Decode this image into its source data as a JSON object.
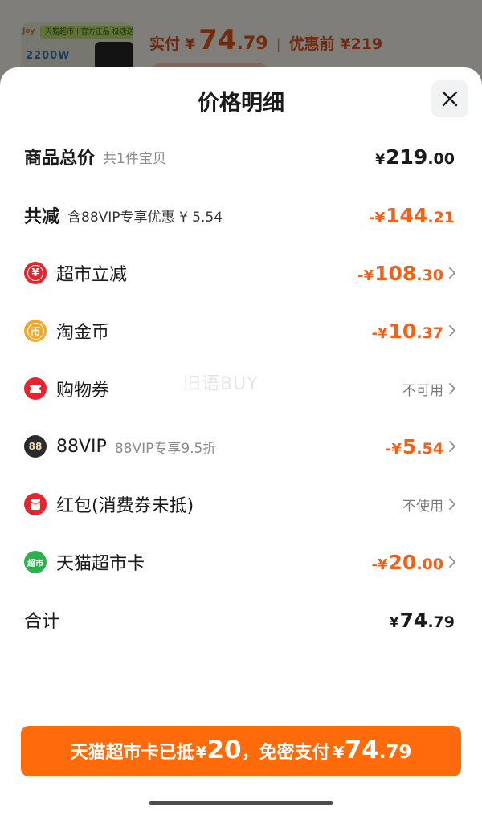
{
  "background": {
    "thumb_tag": "天猫超市 | 官方正品 极速送达",
    "thumb_brand": "Joy",
    "thumb_watt": "2200W",
    "price_label": "实付",
    "price_yen": "¥",
    "price_int": "74",
    "price_dec": ".79",
    "separator": "|",
    "prediscount": "优惠前 ¥219"
  },
  "title": "价格明细",
  "rows": {
    "total": {
      "label": "商品总价",
      "sub": "共1件宝贝",
      "yen": "¥",
      "int": "219",
      "dec": ".00"
    },
    "reduction": {
      "label": "共减",
      "sub": "含88VIP专享优惠 ¥ 5.54",
      "sign": "-¥",
      "int": "144",
      "dec": ".21"
    },
    "supermarket": {
      "label": "超市立减",
      "sign": "-¥",
      "int": "108",
      "dec": ".30"
    },
    "coins": {
      "label": "淘金币",
      "sign": "-¥",
      "int": "10",
      "dec": ".37"
    },
    "voucher": {
      "label": "购物券",
      "status": "不可用"
    },
    "vip": {
      "label": "88VIP",
      "sub": "88VIP专享9.5折",
      "sign": "-¥",
      "int": "5",
      "dec": ".54"
    },
    "redpacket": {
      "label": "红包(消费券未抵)",
      "status": "不使用"
    },
    "tmallcard": {
      "label": "天猫超市卡",
      "sign": "-¥",
      "int": "20",
      "dec": ".00"
    },
    "sum": {
      "label": "合计",
      "yen": "¥",
      "int": "74",
      "dec": ".79"
    }
  },
  "icons": {
    "supermarket": "¥",
    "coins": "币",
    "vip": "88",
    "tmallcard": "超市"
  },
  "watermark": "旧语BUY",
  "pay_button": {
    "part1": "天猫超市卡已抵",
    "card_yen": "¥",
    "card_amount": "20",
    "part2": "，免密支付",
    "pay_yen": "¥",
    "pay_int": "74",
    "pay_dec": ".79"
  },
  "colors": {
    "accent": "#ff6a0a",
    "discount": "#f0621a",
    "red_icon": "#e8232c",
    "coin": "#f5a623",
    "green_card": "#2bb24c"
  }
}
